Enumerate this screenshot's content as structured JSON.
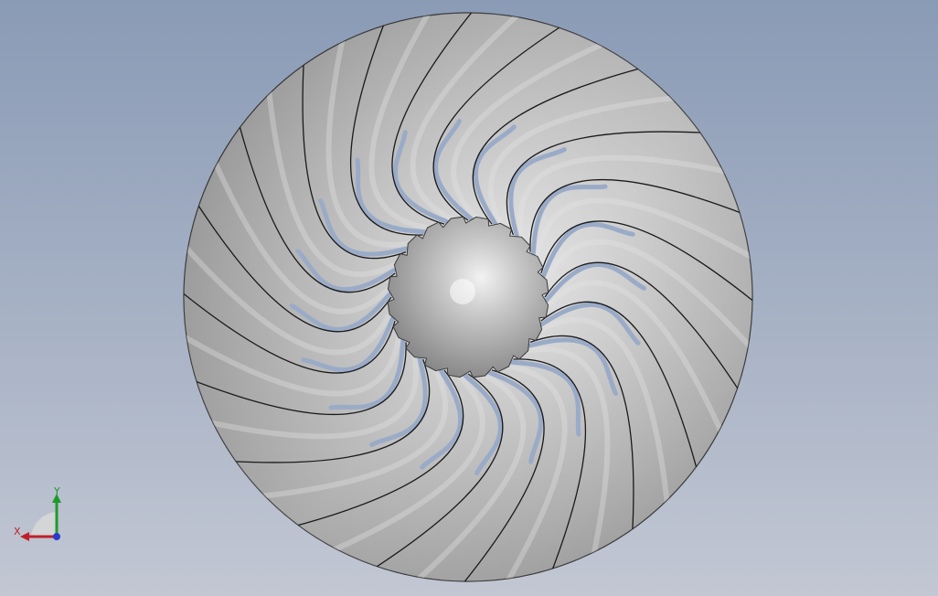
{
  "viewport": {
    "background_top": "#8a9bb6",
    "background_bottom": "#c2c7d3"
  },
  "model": {
    "type": "impeller-fan",
    "blade_count": 20,
    "body_color": "#a8a8a8",
    "edge_color": "#1a1a1a",
    "hub_color": "#b4b4b4"
  },
  "triad": {
    "x_label": "X",
    "y_label": "Y",
    "x_color": "#c0202a",
    "y_color": "#1e9a2a",
    "z_color": "#2a3ad0"
  }
}
